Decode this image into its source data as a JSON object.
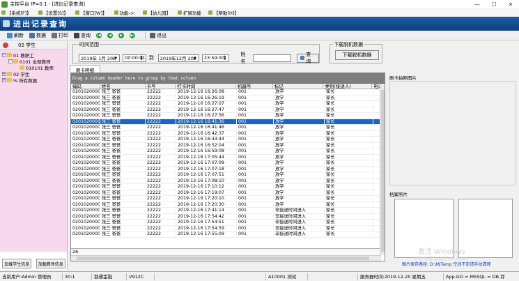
{
  "window": {
    "title": "主控平台 IP=0.1 - [进出记录查询]"
  },
  "menu": [
    "【系统[F]】",
    "【设置[S]】",
    "【窗口[W]】",
    "功能->:",
    "【幼儿园】",
    "扩展功能",
    "【帮助[H]】"
  ],
  "module": {
    "title": "进出记录查询"
  },
  "toolbar": {
    "refresh": "刷新",
    "data": "数据",
    "print": "打印",
    "query": "查询",
    "exit": "退出"
  },
  "left": {
    "header": "02  学生",
    "tree": [
      "01  教职工",
      "0101  全部教师",
      "010101  教师",
      "02  学生",
      "% 所有数据"
    ],
    "btn_student": "加载学生信息",
    "btn_teacher": "加载教师信息"
  },
  "filter": {
    "legend": "时间范围",
    "date_from": "2019年 1月 20E",
    "time_from": "00:00:01",
    "to": "到",
    "date_to": "2019年12月 20E",
    "time_to": "23:59:00",
    "name_label": "姓名",
    "name_value": "",
    "query_btn": "查询"
  },
  "download": {
    "legend": "下载脱机数据",
    "button": "下载脱机数据"
  },
  "tab": "刷卡明细",
  "grid": {
    "group_hint": "Drag a column header here to group by that column",
    "columns": [
      "编码",
      "姓名",
      "卡号",
      "打卡时间",
      "机器号",
      "标记",
      "类别(接送人)",
      "电话"
    ],
    "rows": [
      [
        "020102000001",
        "张三  爸爸",
        "22222",
        "2019-12-16 16:26:08",
        "001",
        "放学",
        "家长"
      ],
      [
        "020102000001",
        "张三  爸爸",
        "22222",
        "2019-12-16 16:26:19",
        "001",
        "放学",
        "家长"
      ],
      [
        "020102000001",
        "张三  爸爸",
        "22222",
        "2019-12-16 16:27:07",
        "001",
        "放学",
        "家长"
      ],
      [
        "020102000001",
        "张三  爸爸",
        "22222",
        "2019-12-16 16:27:47",
        "001",
        "放学",
        "家长"
      ],
      [
        "020102000001",
        "张三  爸爸",
        "22222",
        "2019-12-16 16:27:56",
        "001",
        "放学",
        "家长"
      ],
      [
        "020102000001",
        "张三  爸爸",
        "22222",
        "2019-12-16 16:41:36",
        "001",
        "放学",
        "家长"
      ],
      [
        "020102000001",
        "张三  爸爸",
        "22222",
        "2019-12-16 16:41:46",
        "001",
        "放学",
        "家长"
      ],
      [
        "020102000001",
        "张三  爸爸",
        "22222",
        "2019-12-16 16:42:37",
        "001",
        "放学",
        "家长"
      ],
      [
        "020102000001",
        "张三  爸爸",
        "22222",
        "2019-12-16 16:43:44",
        "001",
        "放学",
        "家长"
      ],
      [
        "020102000001",
        "张三  爸爸",
        "22222",
        "2019-12-16 16:52:04",
        "001",
        "放学",
        "家长"
      ],
      [
        "020102000001",
        "张三  爸爸",
        "22222",
        "2019-12-16 16:59:08",
        "001",
        "放学",
        "家长"
      ],
      [
        "020102000001",
        "张三  爸爸",
        "22222",
        "2019-12-16 17:05:44",
        "001",
        "放学",
        "家长"
      ],
      [
        "020102000001",
        "张三  爸爸",
        "22222",
        "2019-12-16 17:07:09",
        "001",
        "放学",
        "家长"
      ],
      [
        "020102000001",
        "张三  爸爸",
        "22222",
        "2019-12-16 17:07:18",
        "001",
        "放学",
        "家长"
      ],
      [
        "020102000001",
        "张三  爸爸",
        "22222",
        "2019-12-16 17:07:51",
        "001",
        "放学",
        "家长"
      ],
      [
        "020102000001",
        "张三  爸爸",
        "22222",
        "2019-12-16 17:08:10",
        "001",
        "放学",
        "家长"
      ],
      [
        "020102000001",
        "张三  爸爸",
        "22222",
        "2019-12-16 17:10:12",
        "001",
        "放学",
        "家长"
      ],
      [
        "020102000001",
        "张三  爸爸",
        "22222",
        "2019-12-16 17:19:07",
        "001",
        "放学",
        "家长"
      ],
      [
        "020102000001",
        "张三  爸爸",
        "22222",
        "2019-12-16 17:20:10",
        "001",
        "放学",
        "家长"
      ],
      [
        "020102000001",
        "张三  爸爸",
        "22222",
        "2019-12-16 17:20:30",
        "001",
        "放学",
        "家长"
      ],
      [
        "020102000001",
        "张三  爸爸",
        "22222",
        "2019-12-16 17:41:14",
        "001",
        "非接送时间进入",
        "家长"
      ],
      [
        "020102000001",
        "张三  爸爸",
        "22222",
        "2019-12-16 17:54:42",
        "001",
        "非接送时间进入",
        "家长"
      ],
      [
        "020102000001",
        "张三  爸爸",
        "22222",
        "2019-12-16 17:54:51",
        "001",
        "非接送时间进入",
        "家长"
      ],
      [
        "020102000001",
        "张三  爸爸",
        "22222",
        "2019-12-16 17:54:59",
        "001",
        "非接送时间进入",
        "家长"
      ],
      [
        "020102000001",
        "张三  爸爸",
        "22222",
        "2019-12-16 17:55:09",
        "001",
        "非接送时间进入",
        "家长"
      ]
    ],
    "selected_row": 5,
    "footer_count": "26"
  },
  "right": {
    "photo_tab": "刷卡拍照图片",
    "archive_label": "档案照片",
    "path_text": "图片保存路径: D:\\MJTemp  空间不足请手动清理"
  },
  "watermark": {
    "title": "激活 Windows",
    "sub": "转到\"设置\"以激活 Windows。"
  },
  "status": [
    "当前用户:Admin 管理员",
    "30:1",
    "都通金融",
    "V912C",
    "",
    "A10001 测试",
    "",
    "服务器时间:2019-12-20  星期五",
    "App.GO = MSSQL = DB.存"
  ],
  "colors": {
    "header_bg": "#1b5fa8",
    "selection": "#1466c8",
    "tree_bg": "#f8d8ec",
    "path_text": "#1446b0"
  }
}
